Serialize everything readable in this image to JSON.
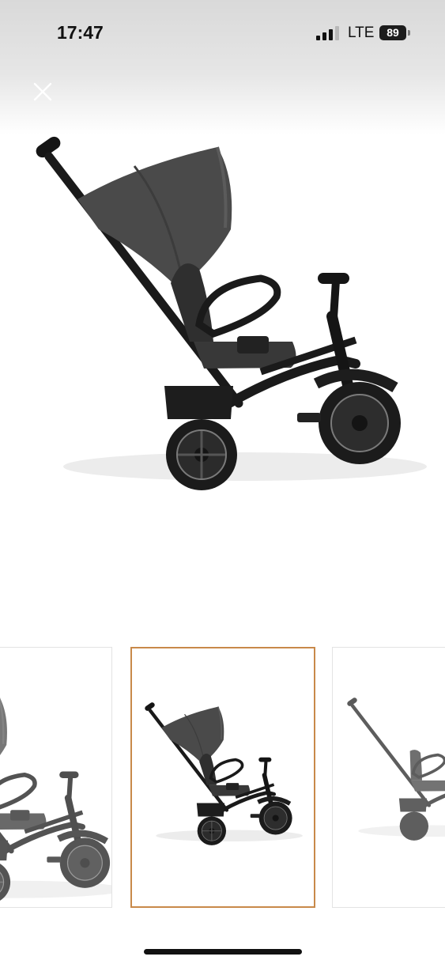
{
  "status_bar": {
    "time": "17:47",
    "carrier": "LTE",
    "battery_level": "89",
    "signal_icon": "signal-bars-icon"
  },
  "viewer": {
    "close_icon": "close-icon",
    "main_image": "tricycle-stroller-side-view",
    "thumbnails": [
      {
        "image": "tricycle-stroller-rear-angle",
        "selected": false
      },
      {
        "image": "tricycle-stroller-side-view",
        "selected": true
      },
      {
        "image": "tricycle-stroller-without-canopy",
        "selected": false
      }
    ],
    "selected_border_color": "#c8894a"
  }
}
